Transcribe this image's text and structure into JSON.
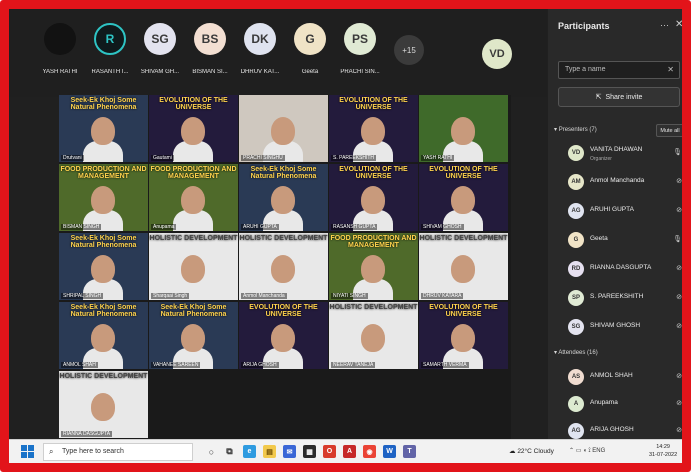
{
  "participants_strip": [
    {
      "initials": "",
      "name": "YASH RATHI",
      "color": "#121212"
    },
    {
      "initials": "R",
      "name": "RASANTH I...",
      "color": "#0f1a1c"
    },
    {
      "initials": "SG",
      "name": "SHIVAM GH...",
      "color": "#e3e3ef"
    },
    {
      "initials": "BS",
      "name": "BISMAN SI...",
      "color": "#f3dfd2"
    },
    {
      "initials": "DK",
      "name": "DHRUV KAT...",
      "color": "#dfe3ef"
    },
    {
      "initials": "G",
      "name": "Geeta",
      "color": "#f0e3c6"
    },
    {
      "initials": "PS",
      "name": "PRACHI SIN...",
      "color": "#e0ead4"
    }
  ],
  "more_count": "+15",
  "self_avatar": "VD",
  "tiles": [
    {
      "caption": "Drutvani",
      "banner": "Seek-Ek Khoj Some Natural Phenomena",
      "bg": "#2a3a55"
    },
    {
      "caption": "Gautami",
      "banner": "EVOLUTION OF THE UNIVERSE",
      "bg": "#231b3c"
    },
    {
      "caption": "PRACHI SINGHU",
      "banner": "",
      "bg": "#cfc8bf"
    },
    {
      "caption": "S. PAREEKSHITH",
      "banner": "EVOLUTION OF THE UNIVERSE",
      "bg": "#231b3c"
    },
    {
      "caption": "YASH RATHI",
      "banner": "",
      "bg": "#3f6a2a"
    },
    {
      "caption": "BISMAN SINGH",
      "banner": "FOOD PRODUCTION AND MANAGEMENT",
      "bg": "#4f6a2a"
    },
    {
      "caption": "Anupama",
      "banner": "FOOD PRODUCTION AND MANAGEMENT",
      "bg": "#4f6a2a"
    },
    {
      "caption": "ARUHI GUPTA",
      "banner": "Seek-Ek Khoj Some Natural Phenomena",
      "bg": "#2a3a55"
    },
    {
      "caption": "RASANSH GUPTA",
      "banner": "EVOLUTION OF THE UNIVERSE",
      "bg": "#231b3c"
    },
    {
      "caption": "SHIVAM GHOSH",
      "banner": "EVOLUTION OF THE UNIVERSE",
      "bg": "#231b3c"
    },
    {
      "caption": "SHRIPAL SINGH",
      "banner": "Seek-Ek Khoj Some Natural Phenomena",
      "bg": "#2a3a55"
    },
    {
      "caption": "Sharqaai Singh",
      "banner": "HOLISTIC DEVELOPMENT",
      "bg": "#e8e8e8"
    },
    {
      "caption": "Anmol Manchanda",
      "banner": "HOLISTIC DEVELOPMENT",
      "bg": "#e8e8e8"
    },
    {
      "caption": "NIYATI SINGH",
      "banner": "FOOD PRODUCTION AND MANAGEMENT",
      "bg": "#4f6a2a"
    },
    {
      "caption": "DHRUV KATARA",
      "banner": "HOLISTIC DEVELOPMENT",
      "bg": "#e8e8e8"
    },
    {
      "caption": "ANMOL SHAH",
      "banner": "Seek-Ek Khoj Some Natural Phenomena",
      "bg": "#2a3a55"
    },
    {
      "caption": "VAHANEE SAREEN",
      "banner": "Seek-Ek Khoj Some Natural Phenomena",
      "bg": "#2a3a55"
    },
    {
      "caption": "ARIJA GHOSH",
      "banner": "EVOLUTION OF THE UNIVERSE",
      "bg": "#231b3c"
    },
    {
      "caption": "NEERAV TANEJA",
      "banner": "HOLISTIC DEVELOPMENT",
      "bg": "#e8e8e8"
    },
    {
      "caption": "SAMARTH VERMA",
      "banner": "EVOLUTION OF THE UNIVERSE",
      "bg": "#231b3c"
    },
    {
      "caption": "RIANNA DASGUPTA",
      "banner": "HOLISTIC DEVELOPMENT",
      "bg": "#e8e8e8"
    }
  ],
  "panel": {
    "title": "Participants",
    "search_placeholder": "Type a name",
    "share_label": "Share invite",
    "presenters_label": "Presenters (7)",
    "mute_all": "Mute all",
    "attendees_label": "Attendees (16)",
    "presenters": [
      {
        "initials": "VD",
        "name": "VANITA DHAWAN",
        "sub": "Organizer",
        "color": "#dfe7c9"
      },
      {
        "initials": "AM",
        "name": "Anmol Manchanda",
        "sub": "",
        "color": "#e7e7c9"
      },
      {
        "initials": "AG",
        "name": "ARUHI GUPTA",
        "sub": "",
        "color": "#e0e4f0"
      },
      {
        "initials": "G",
        "name": "Geeta",
        "sub": "",
        "color": "#f0e3c6"
      },
      {
        "initials": "RD",
        "name": "RIANNA DASGUPTA",
        "sub": "",
        "color": "#e6e0f0"
      },
      {
        "initials": "SP",
        "name": "S. PAREEKSHITH",
        "sub": "",
        "color": "#e0ead4"
      },
      {
        "initials": "SG",
        "name": "SHIVAM GHOSH",
        "sub": "",
        "color": "#e3e3ef"
      }
    ],
    "attendees": [
      {
        "initials": "AS",
        "name": "ANMOL SHAH",
        "color": "#f0dcd0"
      },
      {
        "initials": "A",
        "name": "Anupama",
        "color": "#dcead0"
      },
      {
        "initials": "AG",
        "name": "ARIJA GHOSH",
        "color": "#e0e4f0"
      }
    ]
  },
  "taskbar": {
    "search_placeholder": "Type here to search",
    "weather": "22°C Cloudy",
    "lang": "ENG",
    "time": "14:29",
    "date": "31-07-2022"
  }
}
